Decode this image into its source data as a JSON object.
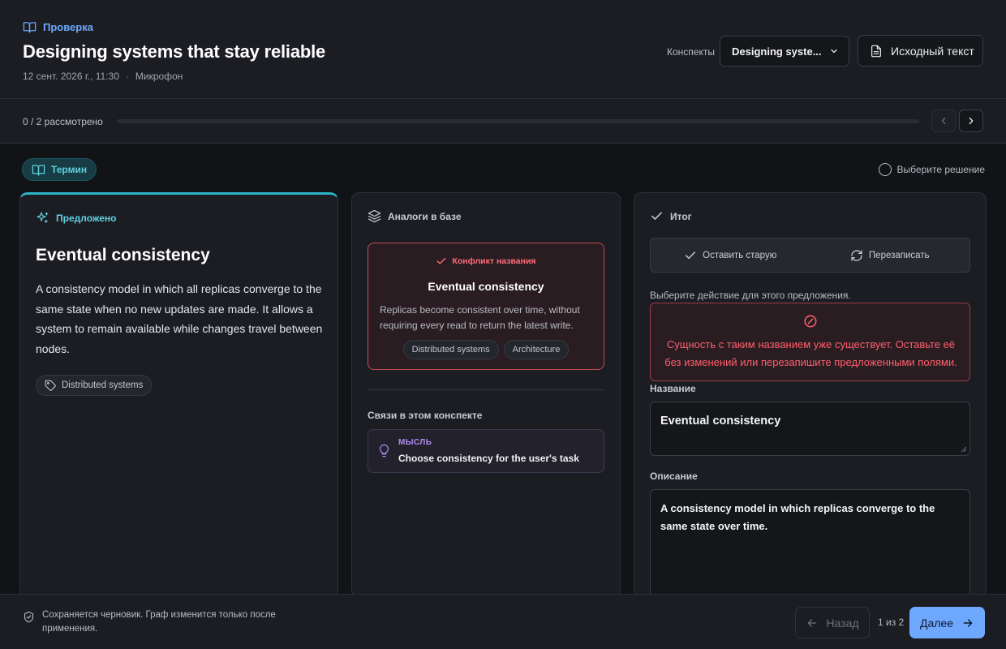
{
  "header": {
    "crumb": "Проверка",
    "title": "Designing systems that stay reliable",
    "date": "12 сент. 2026 г., 11:30",
    "source": "Микрофон",
    "notes_label": "Конспекты",
    "notes_selected": "Designing syste...",
    "source_text_button": "Исходный текст"
  },
  "progress": {
    "text": "0 / 2 рассмотрено",
    "reviewed": 0,
    "total": 2
  },
  "main": {
    "kind_chip": "Термин",
    "decision_hint": "Выберите решение",
    "proposed": {
      "heading": "Предложено",
      "title": "Eventual consistency",
      "description": "A consistency model in which all replicas converge to the same state when no new updates are made. It allows a system to remain available while changes travel between nodes.",
      "tag": "Distributed systems"
    },
    "analogs": {
      "heading": "Аналоги в базе",
      "conflict_label": "Конфликт названия",
      "title": "Eventual consistency",
      "description": "Replicas become consistent over time, without requiring every read to return the latest write.",
      "tags": [
        "Distributed systems",
        "Architecture"
      ],
      "links_title": "Связи в этом конспекте",
      "link_kind": "МЫСЛЬ",
      "link_text": "Choose consistency for the user's task"
    },
    "result": {
      "heading": "Итог",
      "keep_old": "Оставить старую",
      "overwrite": "Перезаписать",
      "hint": "Выберите действие для этого предложения.",
      "error": "Сущность с таким названием уже существует. Оставьте её без изменений или перезапишите предложенными полями.",
      "name_label": "Название",
      "name_value": "Eventual consistency",
      "desc_label": "Описание",
      "desc_value": "A consistency model in which replicas converge to the same state over time."
    }
  },
  "footer": {
    "note": "Сохраняется черновик. Граф изменится только после применения.",
    "back": "Назад",
    "page": "1 из 2",
    "next": "Далее"
  },
  "colors": {
    "accent": "#6ea8fe",
    "teal": "#5fd0e0",
    "danger": "#ff5f6d",
    "thought": "#b28cf0"
  }
}
